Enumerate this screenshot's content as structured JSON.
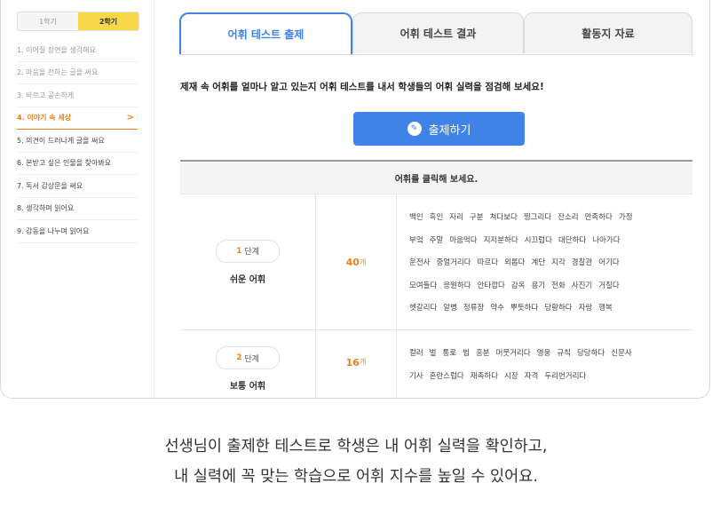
{
  "sidebar": {
    "semesters": [
      "1학기",
      "2학기"
    ],
    "units": [
      "1. 이어질 장면을 생각해요",
      "2. 마음을 전하는 글을 써요",
      "3. 바르고 공손하게",
      "4. 이야기 속 세상",
      "5. 의견이 드러나게 글을 써요",
      "6. 본받고 싶은 인물을 찾아봐요",
      "7. 독서 감상문을 써요",
      "8. 생각하며 읽어요",
      "9. 감동을 나누며 읽어요"
    ],
    "active_arrow": ">"
  },
  "tabs": [
    "어휘 테스트 출제",
    "어휘 테스트 결과",
    "활동지 자료"
  ],
  "instruction": "제재 속 어휘를 얼마나 알고 있는지 어휘 테스트를 내서 학생들의 어휘 실력을 점검해 보세요!",
  "create_button": {
    "label": "출제하기",
    "icon": "test-paper-icon"
  },
  "table": {
    "header": "어휘를 클릭해 보세요.",
    "rows": [
      {
        "step_num": "1",
        "step_label": "단계",
        "level": "쉬운 어휘",
        "count": "40",
        "count_unit": "개",
        "word_lines": [
          [
            "백인",
            "흑인",
            "자리",
            "구분",
            "쳐다보다",
            "찡그리다",
            "잔소리",
            "만족하다",
            "가정"
          ],
          [
            "부엌",
            "주말",
            "마음먹다",
            "지저분하다",
            "시끄럽다",
            "대단하다",
            "나아가다"
          ],
          [
            "운전사",
            "중얼거리다",
            "따르다",
            "외롭다",
            "계단",
            "지각",
            "경찰관",
            "어기다"
          ],
          [
            "모여들다",
            "응원하다",
            "안타깝다",
            "감옥",
            "용기",
            "전화",
            "사진기",
            "거칠다"
          ],
          [
            "헷갈리다",
            "알병",
            "정류장",
            "약수",
            "뿌듯하다",
            "당황하다",
            "자랑",
            "행복"
          ]
        ]
      },
      {
        "step_num": "2",
        "step_label": "단계",
        "level": "보통 어휘",
        "count": "16",
        "count_unit": "개",
        "word_lines": [
          [
            "컬러",
            "벌",
            "통로",
            "법",
            "흥분",
            "머뭇거리다",
            "영웅",
            "규칙",
            "당당하다",
            "신문사"
          ],
          [
            "기사",
            "혼란스럽다",
            "재촉하다",
            "시장",
            "자격",
            "두리번거리다"
          ]
        ]
      }
    ]
  },
  "caption": {
    "line1": "선생님이 출제한 테스트로 학생은 내 어휘 실력을 확인하고,",
    "line2": "내 실력에 꼭 맞는 학습으로 어휘 지수를 높일 수 있어요."
  },
  "colors": {
    "accent": "#3f83e6",
    "highlight": "#f07e1f",
    "semester_active": "#f8d748"
  }
}
